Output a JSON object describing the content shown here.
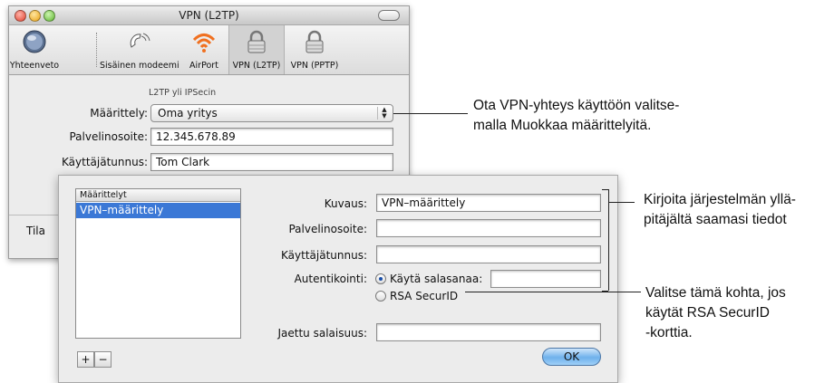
{
  "window": {
    "title": "VPN (L2TP)"
  },
  "toolbar": {
    "items": [
      {
        "label": "Yhteenveto",
        "icon": "globe-icon"
      },
      {
        "label": "Sisäinen modeemi",
        "icon": "phone-icon"
      },
      {
        "label": "AirPort",
        "icon": "wifi-icon"
      },
      {
        "label": "VPN (L2TP)",
        "icon": "lock-icon"
      },
      {
        "label": "VPN (PPTP)",
        "icon": "lock-icon"
      }
    ],
    "selected": "VPN (L2TP)"
  },
  "main": {
    "section_caption": "L2TP yli IPSecin",
    "config_label": "Määrittely:",
    "config_value": "Oma yritys",
    "server_label": "Palvelinosoite:",
    "server_value": "12.345.678.89",
    "user_label": "Käyttäjätunnus:",
    "user_value": "Tom Clark",
    "status_label": "Tila"
  },
  "sheet": {
    "list_header": "Määrittelyt",
    "list_items": [
      "VPN–määrittely"
    ],
    "add_label": "+",
    "remove_label": "−",
    "description_label": "Kuvaus:",
    "description_value": "VPN–määrittely",
    "server_label": "Palvelinosoite:",
    "server_value": "",
    "user_label": "Käyttäjätunnus:",
    "user_value": "",
    "auth_label": "Autentikointi:",
    "auth_password_label": "Käytä salasanaa:",
    "auth_password_value": "",
    "auth_securid_label": "RSA SecurID",
    "auth_selected": "password",
    "shared_secret_label": "Jaettu salaisuus:",
    "shared_secret_value": "",
    "ok_label": "OK"
  },
  "callouts": {
    "config": [
      "Ota VPN-yhteys käyttöön valitse-",
      "malla Muokkaa määrittelyitä."
    ],
    "admin_info": [
      "Kirjoita järjestelmän yllä-",
      "pitäjältä saamasi tiedot"
    ],
    "securid": [
      "Valitse tämä kohta, jos",
      "käytät RSA SecurID",
      "-korttia."
    ]
  },
  "colors": {
    "selection": "#3b78d6",
    "ok_button": "#6fb1ec",
    "airport_orange": "#f07020"
  }
}
